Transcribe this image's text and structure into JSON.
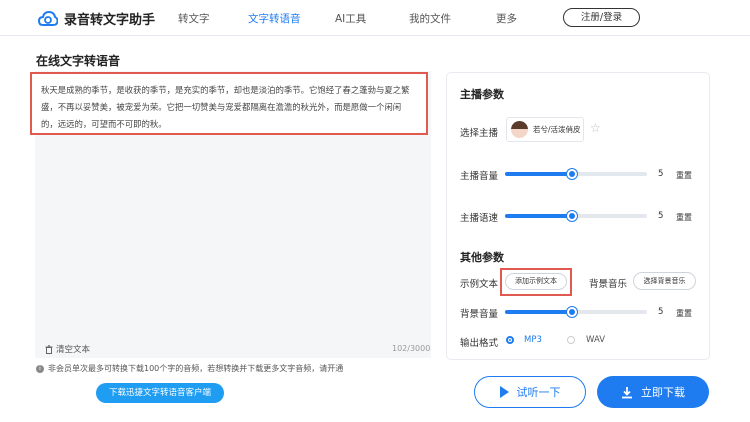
{
  "app": {
    "name": "录音转文字助手"
  },
  "nav": [
    {
      "label": "转文字"
    },
    {
      "label": "文字转语音"
    },
    {
      "label": "AI工具"
    },
    {
      "label": "我的文件"
    },
    {
      "label": "更多"
    }
  ],
  "header": {
    "login_label": "注册/登录"
  },
  "editor": {
    "title": "在线文字转语音",
    "text": "秋天是成熟的季节，是收获的季节，是充实的季节，却也是淡泊的季节。它饱经了春之蓬勃与夏之繁盛，不再以妥赞美，被宠爱为荣。它把一切赞美与宠爱都隔离在澹澹的秋光外，而是愿做一个闲闲的，远远的，可望而不可即的秋。",
    "clear_label": "清空文本",
    "counter": "102/3000"
  },
  "notice": {
    "text": "非会员单次最多可转换下载100个字的音频，若想转换并下载更多文字音频，请开通"
  },
  "client_button": {
    "label": "下载迅捷文字转语音客户端"
  },
  "panel": {
    "host_params_title": "主播参数",
    "select_host_label": "选择主播",
    "host_name": "若兮/活泼俏皮",
    "volume_label": "主播音量",
    "volume_value": "5",
    "volume_level": 0.47,
    "speed_label": "主播语速",
    "speed_value": "5",
    "speed_level": 0.47,
    "reset_label": "重置",
    "other_params_title": "其他参数",
    "sample_text_label": "示例文本",
    "sample_text_button": "添加示例文本",
    "bgm_label": "背景音乐",
    "bgm_button": "选择背景音乐",
    "bg_volume_label": "背景音量",
    "bg_volume_value": "5",
    "bg_volume_level": 0.47,
    "output_format_label": "输出格式",
    "formats": [
      {
        "label": "MP3",
        "selected": true
      },
      {
        "label": "WAV",
        "selected": false
      }
    ]
  },
  "actions": {
    "preview_label": "试听一下",
    "download_label": "立即下载"
  },
  "colors": {
    "accent": "#1e7cf0",
    "highlight": "#e05a4f"
  }
}
